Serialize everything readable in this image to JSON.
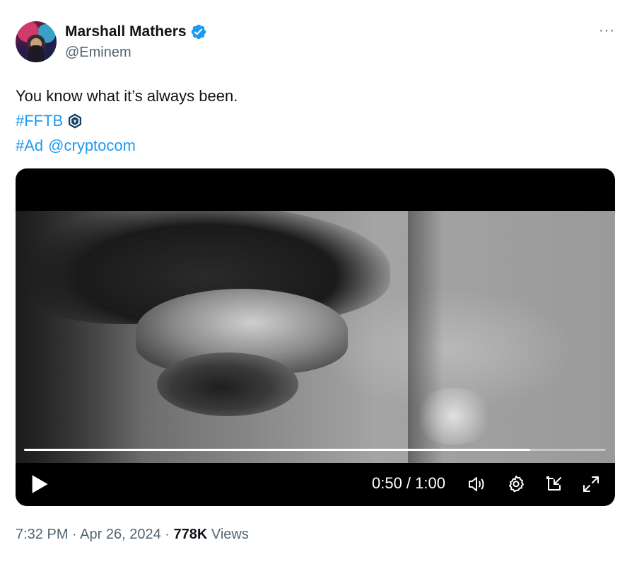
{
  "author": {
    "display_name": "Marshall Mathers",
    "handle": "@Eminem",
    "verified": true,
    "verified_icon": "verified-badge-icon",
    "avatar_icon": "avatar"
  },
  "more_label": "···",
  "tweet": {
    "text_line1": "You know what it’s always been.",
    "hashtag_fftb": "#FFTB",
    "hashtag_ad": "#Ad",
    "mention": "@cryptocom",
    "emoji_icon": "crypto-com-logo-icon"
  },
  "video": {
    "current_time": "0:50",
    "duration": "1:00",
    "time_display": "0:50 / 1:00",
    "progress_fraction": 0.87,
    "controls": [
      "play-icon",
      "volume-icon",
      "settings-icon",
      "picture-in-picture-icon",
      "fullscreen-icon"
    ]
  },
  "meta": {
    "time": "7:32 PM",
    "date": "Apr 26, 2024",
    "views_count": "778K",
    "views_label": "Views",
    "separator": "·"
  },
  "colors": {
    "link": "#1d9bf0",
    "verified": "#1d9bf0",
    "secondary_text": "#536471",
    "primary_text": "#0f1419",
    "cro_blue": "#103f68"
  }
}
